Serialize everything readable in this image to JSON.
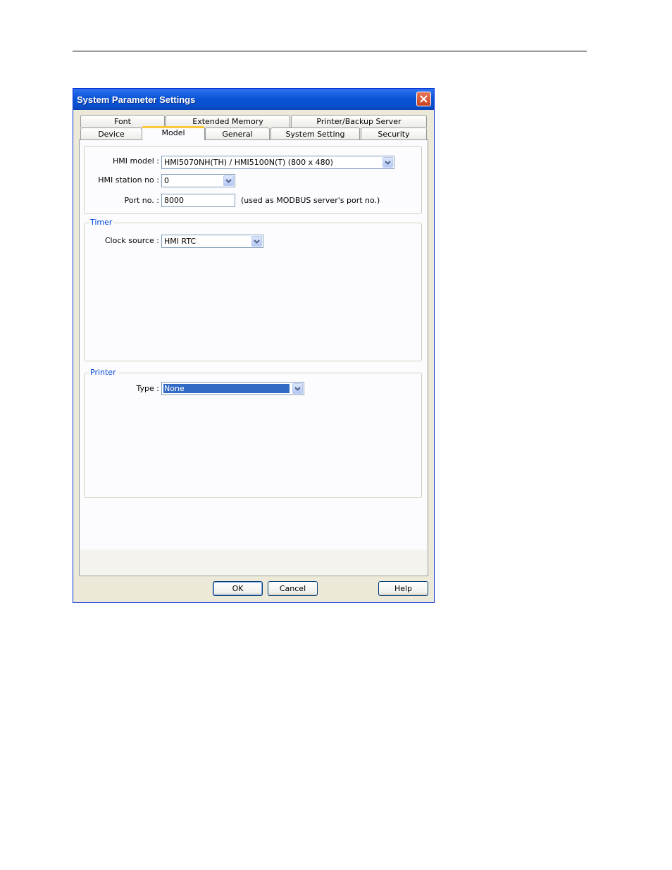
{
  "dialog": {
    "title": "System Parameter Settings"
  },
  "tabs": {
    "row_back": [
      {
        "label": "Font"
      },
      {
        "label": "Extended Memory"
      },
      {
        "label": "Printer/Backup Server"
      }
    ],
    "row_front": [
      {
        "label": "Device"
      },
      {
        "label": "Model",
        "active": true
      },
      {
        "label": "General"
      },
      {
        "label": "System Setting"
      },
      {
        "label": "Security"
      }
    ]
  },
  "model": {
    "hmi_model_label": "HMI model :",
    "hmi_model_value": "HMI5070NH(TH) / HMI5100N(T) (800 x 480)",
    "station_label": "HMI station no :",
    "station_value": "0",
    "port_label": "Port no. :",
    "port_value": "8000",
    "port_hint": "(used as MODBUS server's port no.)"
  },
  "timer": {
    "legend": "Timer",
    "clock_label": "Clock source :",
    "clock_value": "HMI RTC"
  },
  "printer": {
    "legend": "Printer",
    "type_label": "Type :",
    "type_value": "None"
  },
  "buttons": {
    "ok": "OK",
    "cancel": "Cancel",
    "help": "Help"
  }
}
